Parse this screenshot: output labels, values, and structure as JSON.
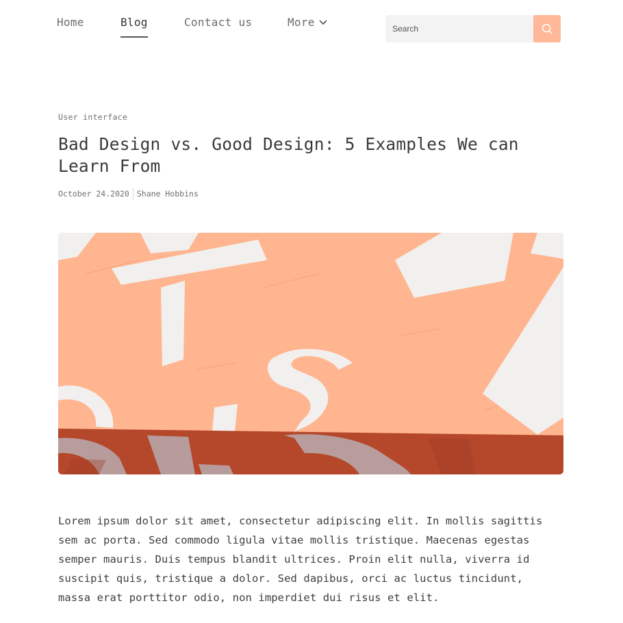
{
  "nav": {
    "home": "Home",
    "blog": "Blog",
    "contact": "Contact us",
    "more": "More"
  },
  "search": {
    "placeholder": "Search"
  },
  "article": {
    "category": "User interface",
    "title": "Bad Design vs. Good Design: 5 Examples We can Learn From",
    "date": "October 24.2020",
    "author": "Shane Hobbins",
    "body": "Lorem ipsum dolor sit amet, consectetur adipiscing elit. In mollis sagittis sem ac porta. Sed commodo ligula vitae mollis tristique. Maecenas egestas semper mauris. Duis tempus blandit ultrices. Proin elit nulla, viverra id suscipit quis, tristique a dolor. Sed dapibus, orci ac luctus tincidunt, massa erat porttitor odio, non imperdiet dui risus et elit."
  },
  "colors": {
    "accent": "#ffb898",
    "hero_peach": "#ffb58f",
    "hero_rust": "#b5472b",
    "hero_letters": "#f2f0ee"
  },
  "icons": {
    "search": "search-icon",
    "more": "chevron-down-icon"
  }
}
